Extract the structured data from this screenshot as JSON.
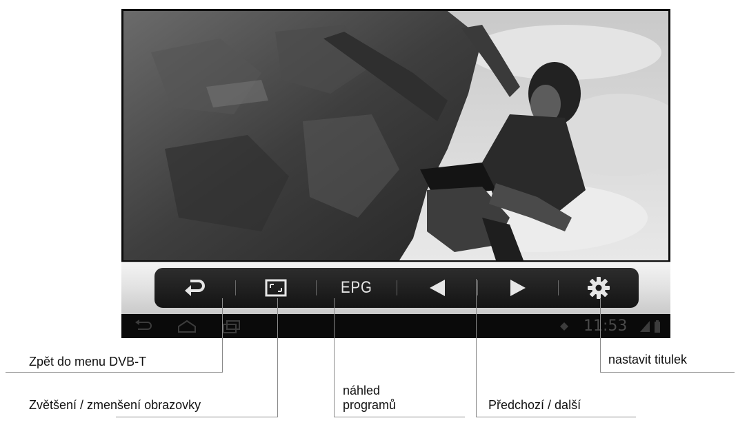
{
  "player": {
    "controls": {
      "epg_label": "EPG"
    },
    "status_bar": {
      "time": "11:53"
    }
  },
  "callouts": {
    "back": "Zpět do menu DVB-T",
    "zoom": "Zvětšení / zmenšení obrazovky",
    "epg_line1": "náhled",
    "epg_line2": "programů",
    "prev_next": "Předchozí / další",
    "subtitles": "nastavit titulek"
  },
  "icons": {
    "back": "return-arrow-icon",
    "zoom": "aspect-ratio-icon",
    "prev": "triangle-left-icon",
    "next": "triangle-right-icon",
    "settings": "gear-icon"
  }
}
